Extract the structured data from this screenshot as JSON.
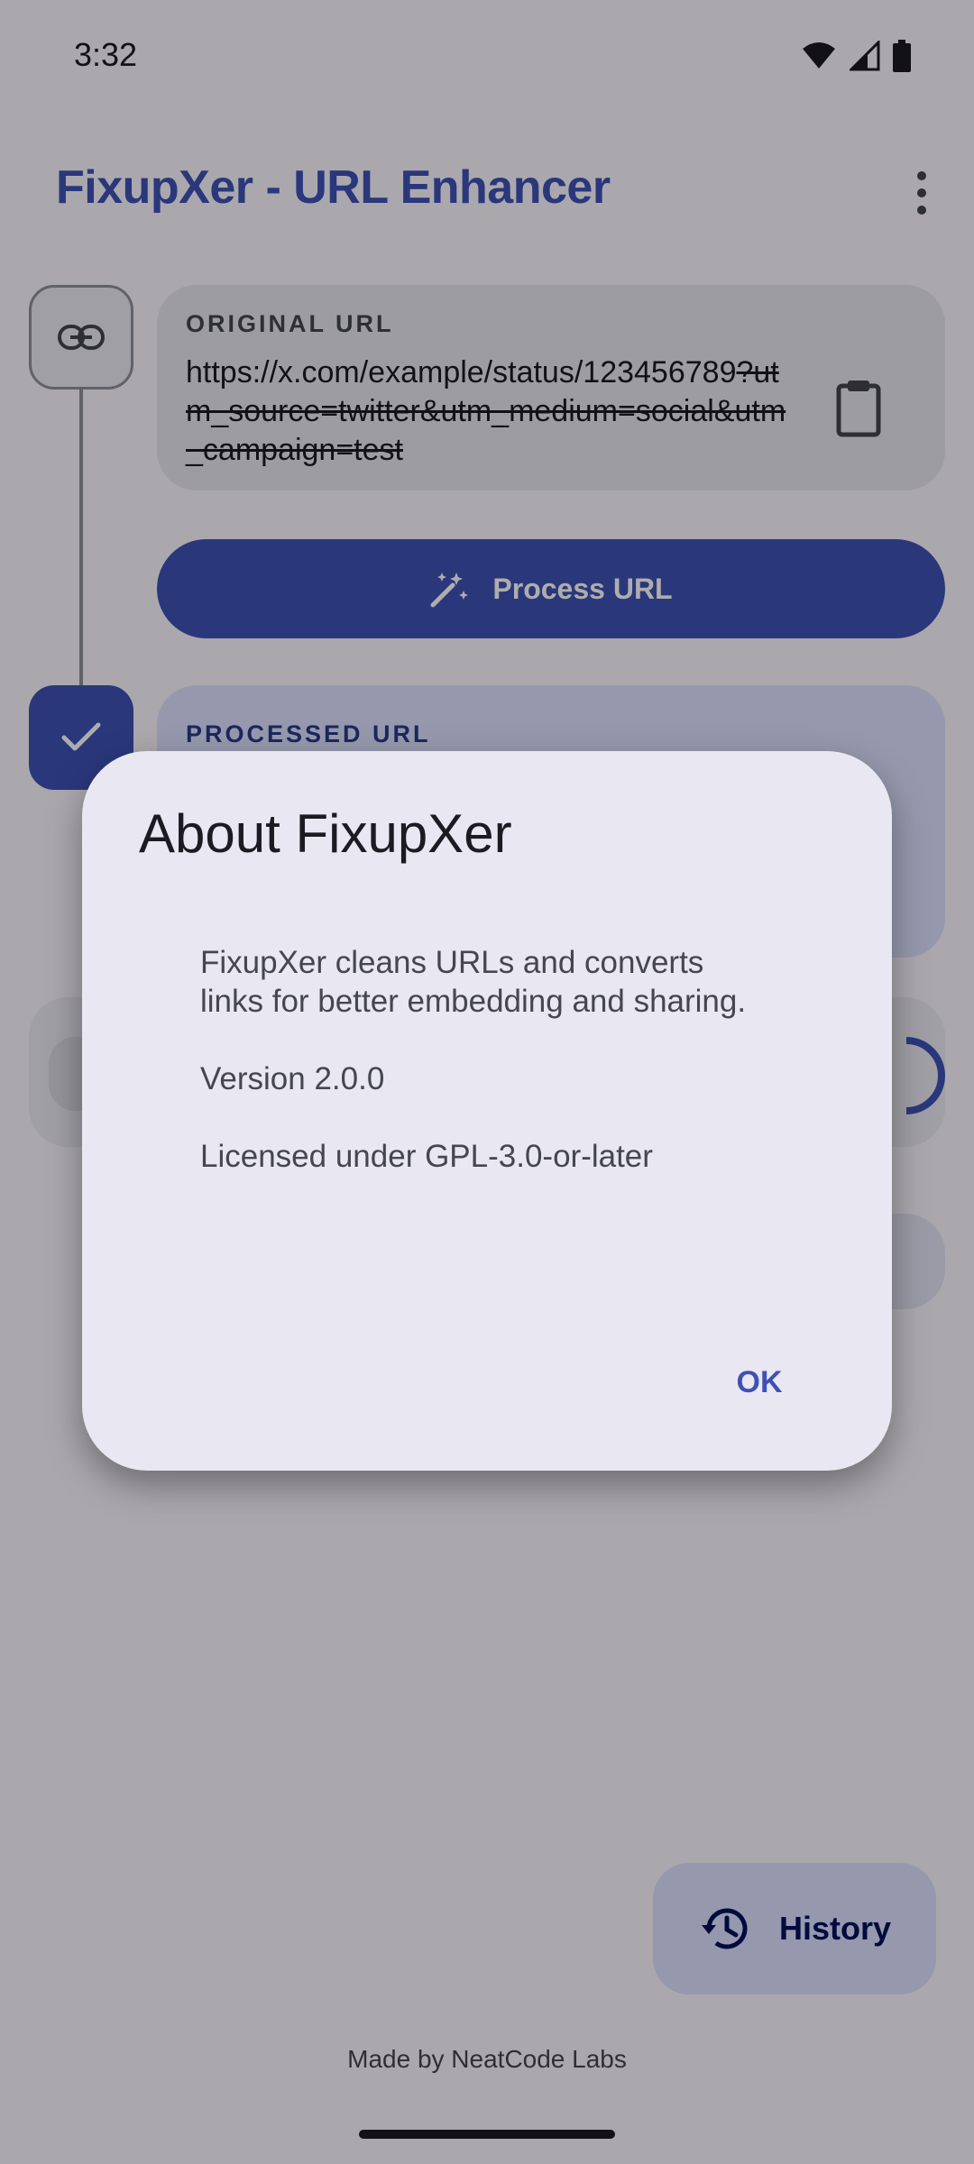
{
  "status_bar": {
    "time": "3:32",
    "icons": [
      "wifi-icon",
      "signal-icon",
      "battery-icon"
    ]
  },
  "app_bar": {
    "title": "FixupXer - URL Enhancer",
    "menu_icon": "more-vert-icon"
  },
  "original": {
    "label": "ORIGINAL URL",
    "url_kept": "https://x.com/example/status/123456789",
    "url_removed": "?utm_source=twitter&utm_medium=social&utm_campaign=test",
    "paste_icon": "clipboard-icon"
  },
  "process_button": {
    "label": "Process URL",
    "icon": "magic-wand-icon"
  },
  "processed": {
    "label": "PROCESSED URL"
  },
  "history_button": {
    "label": "History",
    "icon": "history-icon"
  },
  "footer": {
    "text": "Made by NeatCode Labs"
  },
  "dialog": {
    "title": "About FixupXer",
    "description": "FixupXer cleans URLs and converts links for better embedding and sharing.",
    "version": "Version 2.0.0",
    "license": "Licensed under GPL-3.0-or-later",
    "ok_label": "OK"
  },
  "colors": {
    "primary": "#3f51b5",
    "surface": "#e9e7f1",
    "scrim": "rgba(0,0,0,0.32)"
  }
}
